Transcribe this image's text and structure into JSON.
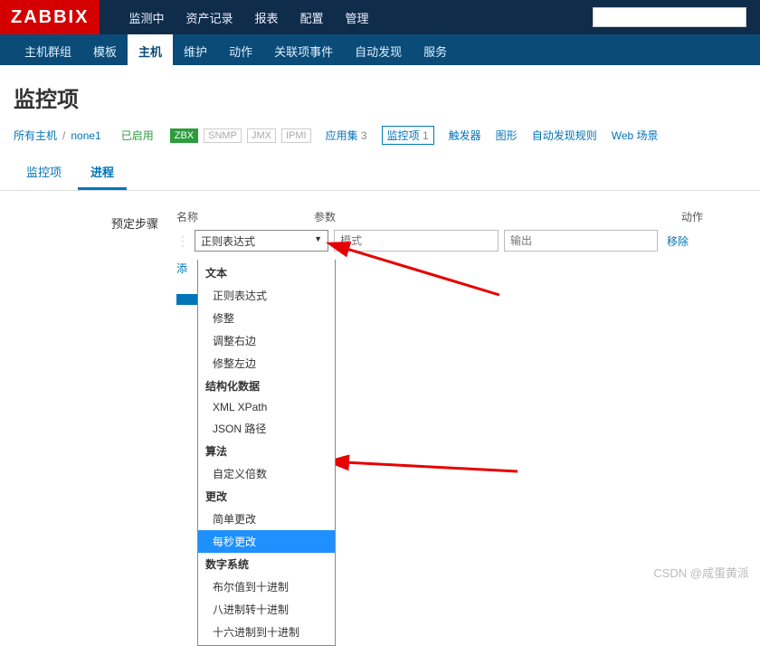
{
  "logo": "ZABBIX",
  "topnav": {
    "items": [
      "监测中",
      "资产记录",
      "报表",
      "配置",
      "管理"
    ],
    "active": 3
  },
  "subnav": {
    "items": [
      "主机群组",
      "模板",
      "主机",
      "维护",
      "动作",
      "关联项事件",
      "自动发现",
      "服务"
    ],
    "active": 2
  },
  "page_title": "监控项",
  "breadcrumb": {
    "all_hosts": "所有主机",
    "host": "none1",
    "status": "已启用",
    "badges": {
      "zbx": "ZBX",
      "snmp": "SNMP",
      "jmx": "JMX",
      "ipmi": "IPMI"
    },
    "links": {
      "apps": "应用集",
      "apps_count": "3",
      "items": "监控项",
      "items_count": "1",
      "triggers": "触发器",
      "graphs": "图形",
      "discovery": "自动发现规则",
      "web": "Web 场景"
    }
  },
  "tabs": {
    "items": [
      "监控项",
      "进程"
    ],
    "active": 1
  },
  "form": {
    "steps_label": "预定步骤",
    "col_name": "名称",
    "col_params": "参数",
    "col_action": "动作",
    "selected": "正则表达式",
    "placeholder_pattern": "模式",
    "placeholder_output": "输出",
    "remove": "移除",
    "add": "添",
    "submit_partial": ""
  },
  "dropdown": {
    "groups": [
      {
        "label": "文本",
        "options": [
          "正则表达式",
          "修整",
          "调整右边",
          "修整左边"
        ]
      },
      {
        "label": "结构化数据",
        "options": [
          "XML XPath",
          "JSON 路径"
        ]
      },
      {
        "label": "算法",
        "options": [
          "自定义倍数"
        ]
      },
      {
        "label": "更改",
        "options": [
          "简单更改",
          "每秒更改"
        ]
      },
      {
        "label": "数字系统",
        "options": [
          "布尔值到十进制",
          "八进制转十进制",
          "十六进制到十进制"
        ]
      }
    ],
    "selected": "每秒更改"
  },
  "watermark": "CSDN @咸蛋黄派"
}
